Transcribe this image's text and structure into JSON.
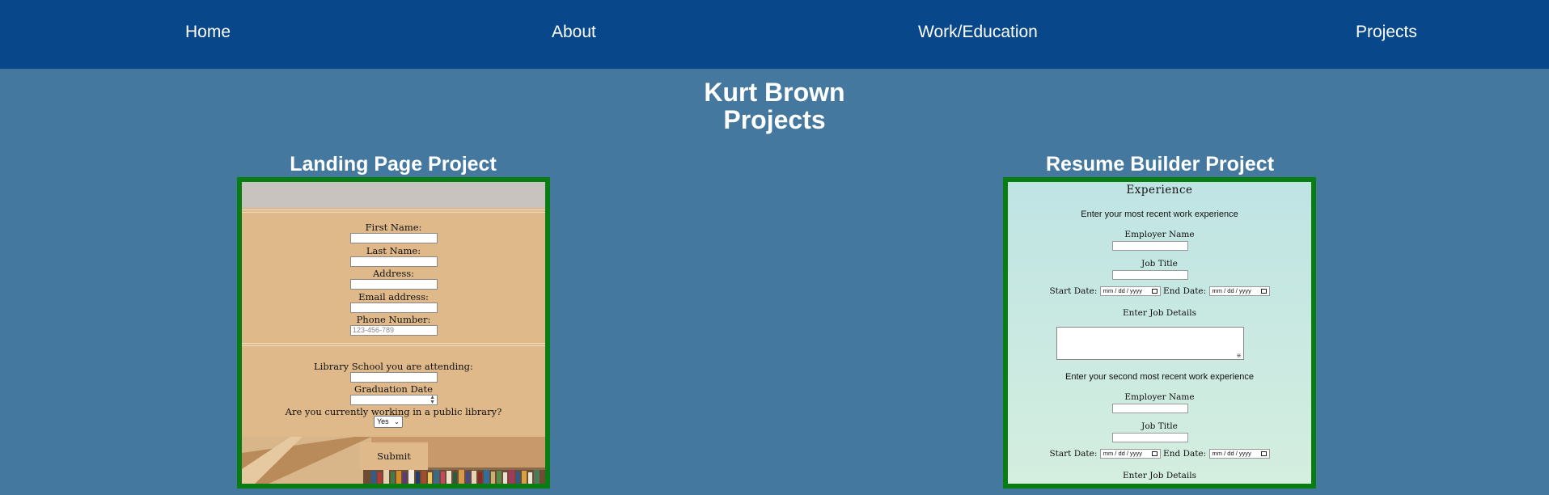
{
  "nav": {
    "home": "Home",
    "about": "About",
    "work": "Work/Education",
    "projects": "Projects"
  },
  "header": {
    "name": "Kurt Brown",
    "subtitle": "Projects"
  },
  "landing": {
    "title": "Landing Page Project",
    "first_name_label": "First Name:",
    "last_name_label": "Last Name:",
    "address_label": "Address:",
    "email_label": "Email address:",
    "phone_label": "Phone Number:",
    "phone_placeholder": "123-456-789",
    "school_label": "Library School you are attending:",
    "grad_label": "Graduation Date",
    "working_question": "Are you currently working in a public library?",
    "working_selected": "Yes",
    "submit_label": "Submit"
  },
  "resume": {
    "title": "Resume Builder Project",
    "section_heading": "Experience",
    "recent_prompt": "Enter your most recent work experience",
    "second_prompt": "Enter your second most recent work experience",
    "employer_label": "Employer Name",
    "job_title_label": "Job Title",
    "start_label": "Start Date:",
    "end_label": "End Date:",
    "date_placeholder": "mm / dd / yyyy",
    "details_label": "Enter Job Details"
  },
  "colors": {
    "nav_bg": "#07478a",
    "page_bg": "#44789f",
    "frame_border": "#0a7d12",
    "landing_bg": "#dfb98a",
    "resume_bg": "#bfe4e4"
  }
}
